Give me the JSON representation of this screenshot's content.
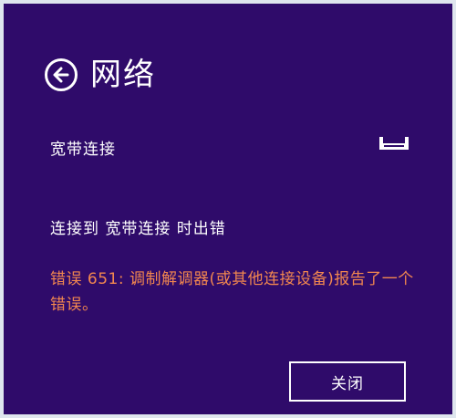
{
  "header": {
    "title": "网络",
    "back_icon": "back-arrow-icon"
  },
  "connection": {
    "name": "宽带连接",
    "icon": "router-icon"
  },
  "error": {
    "heading": "连接到 宽带连接 时出错",
    "message": "错误 651: 调制解调器(或其他连接设备)报告了一个错误。",
    "color": "#f2874f"
  },
  "actions": {
    "close_label": "关闭"
  },
  "colors": {
    "background": "#2f0b6a",
    "text": "#ffffff"
  }
}
